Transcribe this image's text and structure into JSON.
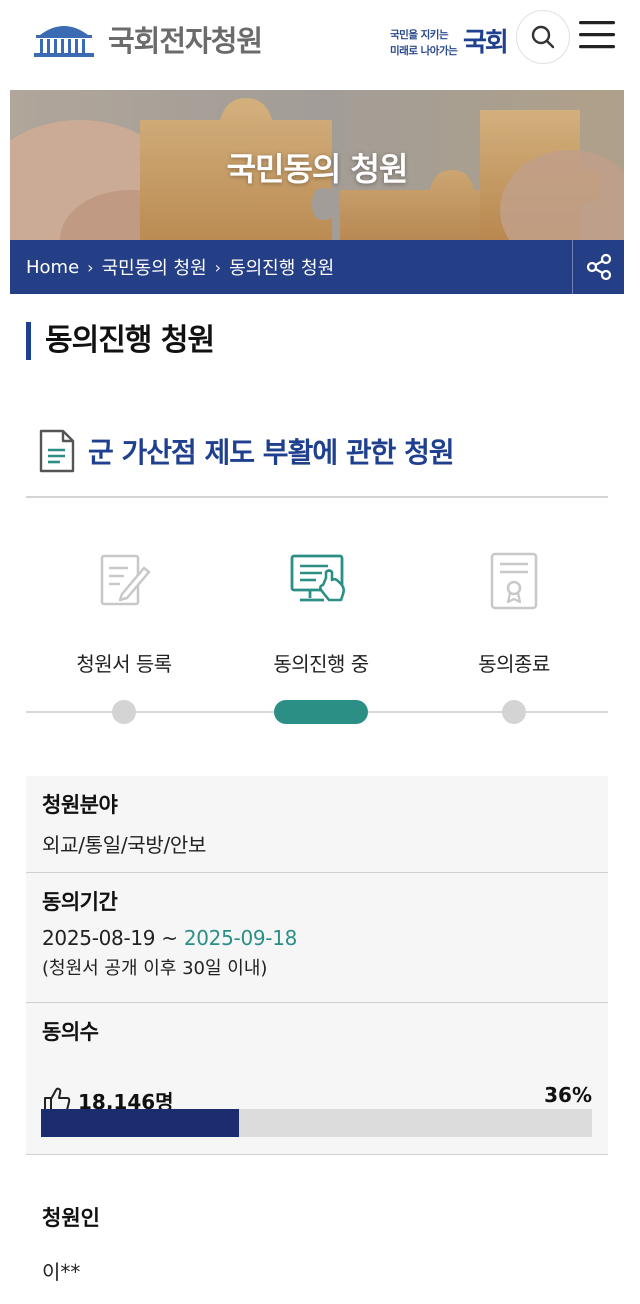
{
  "header": {
    "logo_text": "국회전자청원",
    "slogan_line1": "국민을 지키는",
    "slogan_line2": "미래로 나아가는",
    "slogan_big": "국회"
  },
  "banner": {
    "title": "국민동의 청원",
    "breadcrumb": [
      "Home",
      "국민동의 청원",
      "동의진행 청원"
    ]
  },
  "page": {
    "title": "동의진행 청원"
  },
  "petition": {
    "title": "군 가산점 제도 부활에 관한 청원"
  },
  "steps": [
    {
      "label": "청원서 등록",
      "active": false
    },
    {
      "label": "동의진행 중",
      "active": true
    },
    {
      "label": "동의종료",
      "active": false
    }
  ],
  "info": {
    "field_label": "청원분야",
    "field_value": "외교/통일/국방/안보",
    "period_label": "동의기간",
    "period_start": "2025-08-19",
    "period_sep": "~",
    "period_end": "2025-09-18",
    "period_note": "(청원서 공개 이후 30일 이내)",
    "count_label": "동의수",
    "count_value": "18,146명",
    "percent_text": "36%",
    "progress": 0.36
  },
  "petitioner": {
    "label": "청원인",
    "value": "이**"
  },
  "colors": {
    "brand_navy": "#1f3f8f",
    "breadcrumb_bg": "#253f87",
    "accent_teal": "#2b8f86",
    "progress_fill": "#1b2d6e"
  }
}
